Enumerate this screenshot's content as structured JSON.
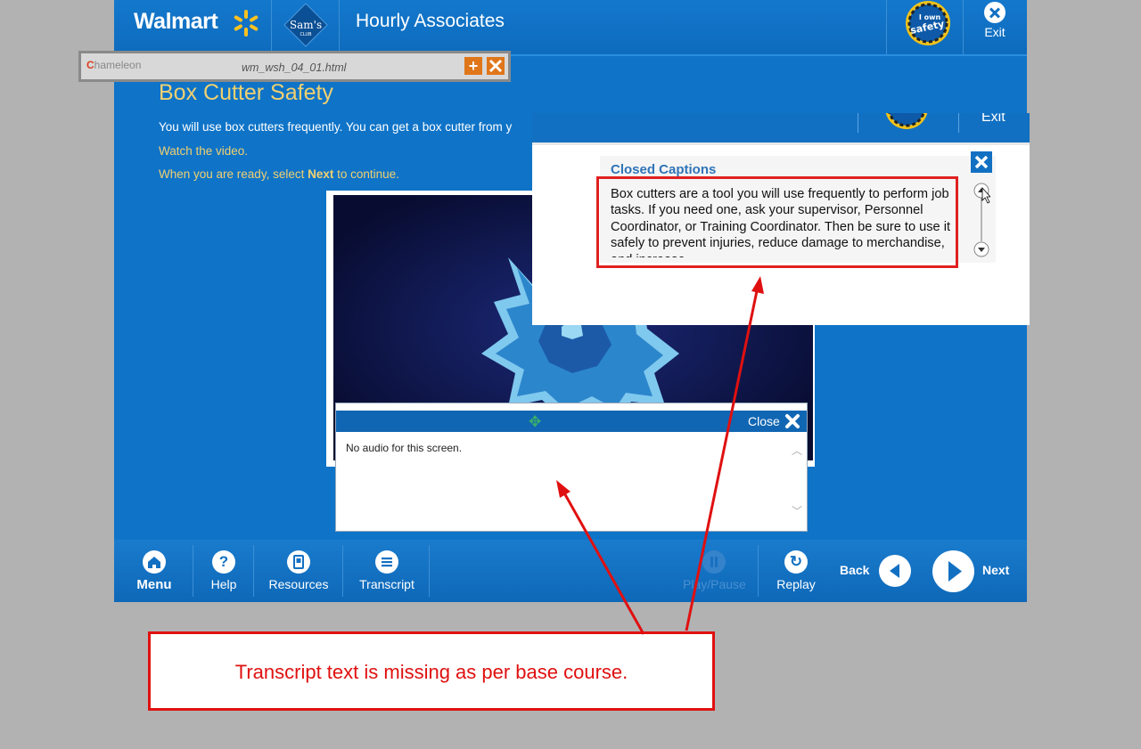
{
  "header": {
    "brand": "Walmart",
    "sams_label": "Sam's",
    "sams_sub": "CLUB",
    "title": "Hourly Associates",
    "badge_top": "I own",
    "badge_bottom": "safety",
    "exit_label": "Exit"
  },
  "chameleon": {
    "logo_text": "hameleon",
    "filename": "wm_wsh_04_01.html",
    "plus": "+"
  },
  "content": {
    "title": "Box Cutter Safety",
    "intro": "You will use box cutters frequently.  You can get a box cutter from y",
    "watch": "Watch the video.",
    "ready_prefix": "When you are ready, select ",
    "ready_bold": "Next",
    "ready_suffix": " to continue."
  },
  "transcript_panel": {
    "move_icon": "✥",
    "close_label": "Close",
    "text": "No audio for this screen.",
    "scroll_up": "︿",
    "scroll_down": "﹀"
  },
  "closed_captions": {
    "exit_label": "Exit",
    "title": "Closed Captions",
    "text": "Box cutters are a tool you will use frequently to perform job tasks.  If you need one, ask your supervisor, Personnel Coordinator, or Training Coordinator.  Then be sure to use it safely to prevent injuries, reduce damage to merchandise, and increase"
  },
  "nav": {
    "menu": "Menu",
    "help": "Help",
    "resources": "Resources",
    "transcript": "Transcript",
    "playpause": "Play/Pause",
    "replay": "Replay",
    "back": "Back",
    "next": "Next",
    "help_glyph": "?",
    "replay_glyph": "↻"
  },
  "annotation": {
    "note": "Transcript text is missing as per base course."
  },
  "colors": {
    "course_blue": "#0f74c8",
    "title_gold": "#f0d070",
    "annotation_red": "#e01010"
  }
}
